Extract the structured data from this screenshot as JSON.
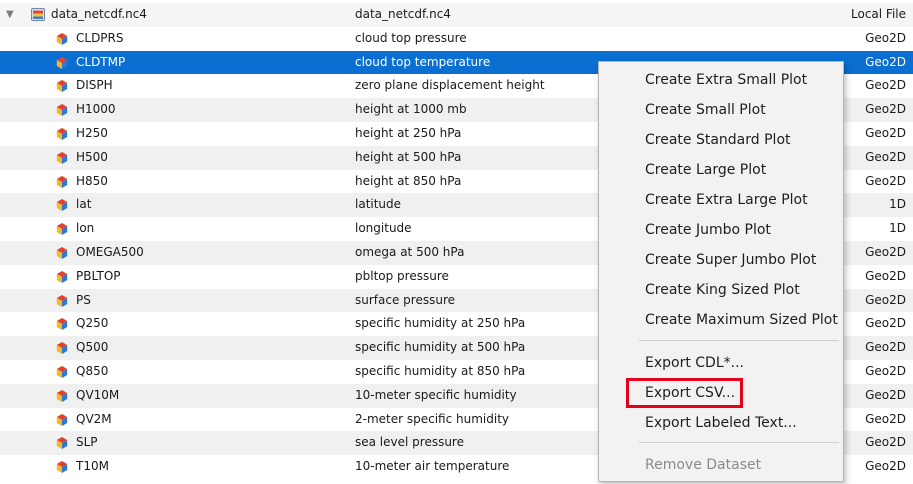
{
  "dataset": {
    "name": "data_netcdf.nc4",
    "title": "data_netcdf.nc4",
    "location": "Local File",
    "expand_glyph": "▼"
  },
  "variables": [
    {
      "name": "CLDPRS",
      "description": "cloud top pressure",
      "type": "Geo2D"
    },
    {
      "name": "CLDTMP",
      "description": "cloud top temperature",
      "type": "Geo2D"
    },
    {
      "name": "DISPH",
      "description": "zero plane displacement height",
      "type": "Geo2D"
    },
    {
      "name": "H1000",
      "description": "height at 1000 mb",
      "type": "Geo2D"
    },
    {
      "name": "H250",
      "description": "height at 250 hPa",
      "type": "Geo2D"
    },
    {
      "name": "H500",
      "description": "height at 500 hPa",
      "type": "Geo2D"
    },
    {
      "name": "H850",
      "description": "height at 850 hPa",
      "type": "Geo2D"
    },
    {
      "name": "lat",
      "description": "latitude",
      "type": "1D"
    },
    {
      "name": "lon",
      "description": "longitude",
      "type": "1D"
    },
    {
      "name": "OMEGA500",
      "description": "omega at 500 hPa",
      "type": "Geo2D"
    },
    {
      "name": "PBLTOP",
      "description": "pbltop pressure",
      "type": "Geo2D"
    },
    {
      "name": "PS",
      "description": "surface pressure",
      "type": "Geo2D"
    },
    {
      "name": "Q250",
      "description": "specific humidity at 250 hPa",
      "type": "Geo2D"
    },
    {
      "name": "Q500",
      "description": "specific humidity at 500 hPa",
      "type": "Geo2D"
    },
    {
      "name": "Q850",
      "description": "specific humidity at 850 hPa",
      "type": "Geo2D"
    },
    {
      "name": "QV10M",
      "description": "10-meter specific humidity",
      "type": "Geo2D"
    },
    {
      "name": "QV2M",
      "description": "2-meter specific humidity",
      "type": "Geo2D"
    },
    {
      "name": "SLP",
      "description": "sea level pressure",
      "type": "Geo2D"
    },
    {
      "name": "T10M",
      "description": "10-meter air temperature",
      "type": "Geo2D"
    }
  ],
  "selected_variable": "CLDTMP",
  "context_menu": {
    "plot_items": [
      "Create Extra Small Plot",
      "Create Small Plot",
      "Create Standard Plot",
      "Create Large Plot",
      "Create Extra Large Plot",
      "Create Jumbo Plot",
      "Create Super Jumbo Plot",
      "Create King Sized Plot",
      "Create Maximum Sized Plot"
    ],
    "export_items": [
      "Export CDL*...",
      "Export CSV...",
      "Export Labeled Text..."
    ],
    "remove_item": "Remove Dataset",
    "highlighted_item": "Export CSV..."
  },
  "colors": {
    "selection": "#0a6fd1",
    "highlight_box": "#e3001b",
    "row_alt": "#f0f0f0",
    "menu_bg": "#f2f2f2",
    "disabled_text": "#8a8a8a"
  },
  "icons": {
    "dataset": "dataset-file-icon",
    "variable": "variable-icon"
  }
}
